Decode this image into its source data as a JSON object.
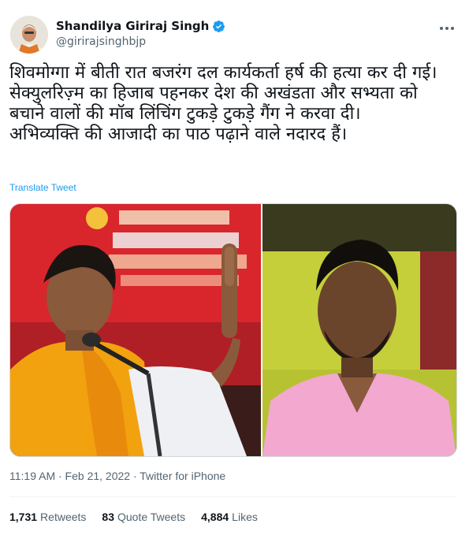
{
  "author": {
    "name": "Shandilya Giriraj Singh",
    "handle": "@girirajsinghbjp",
    "verified": true
  },
  "tweet": {
    "text_lines": [
      "शिवमोग्गा में बीती रात बजरंग दल कार्यकर्ता हर्ष की हत्या कर दी गई।",
      "सेक्युलरिज़्म का हिजाब पहनकर देश की अखंडता और सभ्यता को बचाने वालों की मॉब लिंचिंग टुकड़े टुकड़े गैंग ने करवा दी।",
      "अभिव्यक्ति की आजादी का पाठ पढ़ाने वाले नदारद हैं।"
    ],
    "translate_label": "Translate Tweet",
    "timestamp": "11:19 AM · Feb 21, 2022 · Twitter for iPhone"
  },
  "stats": {
    "retweets_count": "1,731",
    "retweets_label": "Retweets",
    "quotes_count": "83",
    "quotes_label": "Quote Tweets",
    "likes_count": "4,884",
    "likes_label": "Likes"
  },
  "icons": {
    "verified": "verified-badge-icon",
    "more": "more-options-icon"
  },
  "colors": {
    "accent": "#1d9bf0",
    "banner_red": "#d8262c",
    "saffron": "#f2a20f",
    "shirt_pink": "#f2a8cf",
    "wall_green": "#c4cf3a"
  }
}
